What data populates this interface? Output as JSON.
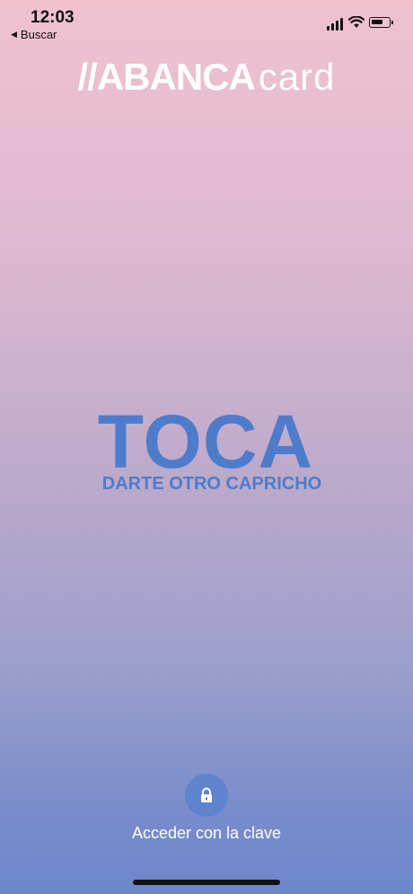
{
  "status_bar": {
    "time": "12:03",
    "back_label": "Buscar"
  },
  "brand": {
    "name_bold": "//ABANCA",
    "name_light": "card"
  },
  "promo": {
    "headline": "TOCA",
    "tagline": "DARTE OTRO CAPRICHO"
  },
  "access": {
    "label": "Acceder con la clave",
    "icon": "lock-icon"
  },
  "colors": {
    "promo_text": "#4f7bcb",
    "lock_button": "#5e84ce",
    "gradient_top": "#f0c2d0",
    "gradient_bottom": "#6c87c9"
  }
}
